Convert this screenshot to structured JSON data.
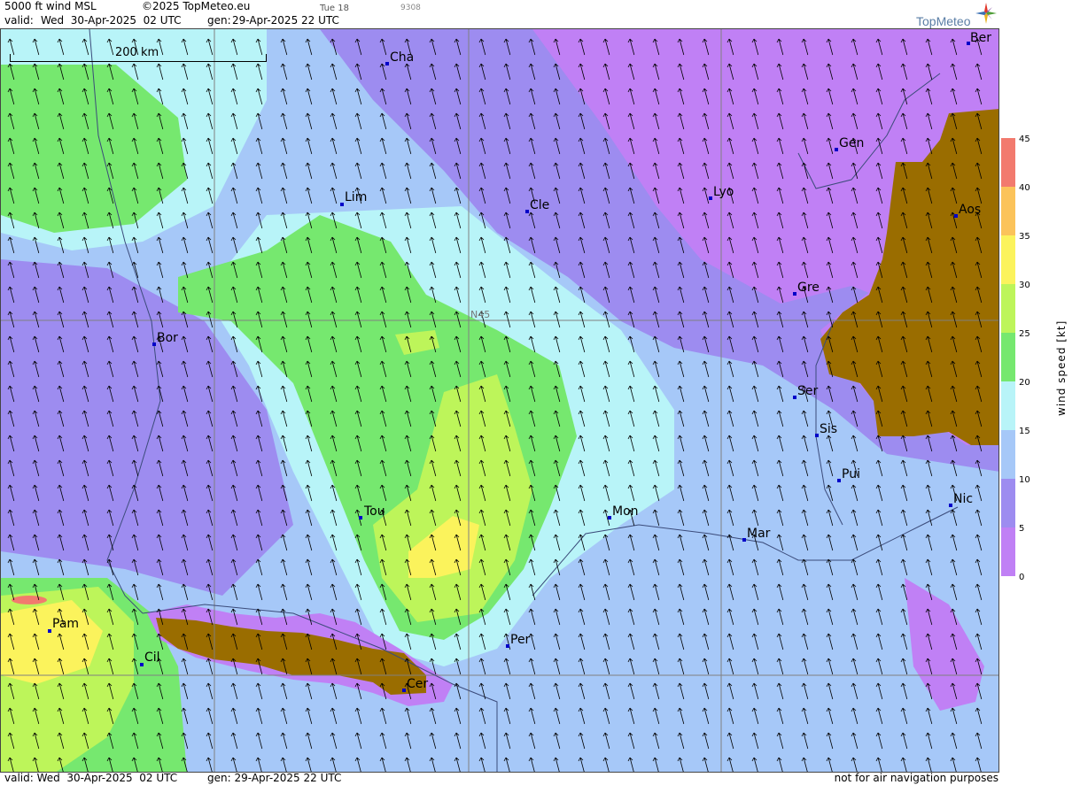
{
  "header": {
    "product": "5000 ft wind MSL",
    "copyright": "©2025 TopMeteo.eu",
    "day_code": "Tue 18",
    "run_code": "9308",
    "valid_label": "valid:",
    "valid_time": "Wed  30-Apr-2025  02 UTC",
    "gen_label": "gen:",
    "gen_time": "29-Apr-2025 22 UTC"
  },
  "logo": {
    "text": "TopMeteo",
    "icon": "compass-star-icon"
  },
  "footer": {
    "valid_label": "valid:",
    "valid_time": "Wed  30-Apr-2025  02 UTC",
    "gen_label": "gen:",
    "gen_time": "29-Apr-2025 22 UTC",
    "disclaimer": "not for air navigation purposes"
  },
  "map": {
    "scale_bar_label": "200 km",
    "latitude_label": "N45",
    "wind_direction": "from south-southeast (arrows point north-northwest)",
    "cities": [
      {
        "name": "Cha"
      },
      {
        "name": "Ber"
      },
      {
        "name": "Gen"
      },
      {
        "name": "Lim"
      },
      {
        "name": "Cle"
      },
      {
        "name": "Lyo"
      },
      {
        "name": "Aos"
      },
      {
        "name": "Gre"
      },
      {
        "name": "Bor"
      },
      {
        "name": "Ser"
      },
      {
        "name": "Sis"
      },
      {
        "name": "Pui"
      },
      {
        "name": "Tou"
      },
      {
        "name": "Mon"
      },
      {
        "name": "Mar"
      },
      {
        "name": "Nic"
      },
      {
        "name": "Pam"
      },
      {
        "name": "Cil"
      },
      {
        "name": "Per"
      },
      {
        "name": "Cer"
      }
    ]
  },
  "legend": {
    "title": "wind speed [kt]",
    "ticks": [
      "45",
      "40",
      "35",
      "30",
      "25",
      "20",
      "15",
      "10",
      "5",
      "0"
    ],
    "colors": {
      "0-5": "#c080f5",
      "5-10": "#9d8cf0",
      "10-15": "#a6c8f8",
      "15-20": "#b8f4f8",
      "20-25": "#76e86f",
      "25-30": "#bdf55a",
      "30-35": "#fbf35c",
      "35-40": "#fbc35a",
      "40-45": "#f27a6e",
      "terrain": "#9a6d00"
    }
  }
}
